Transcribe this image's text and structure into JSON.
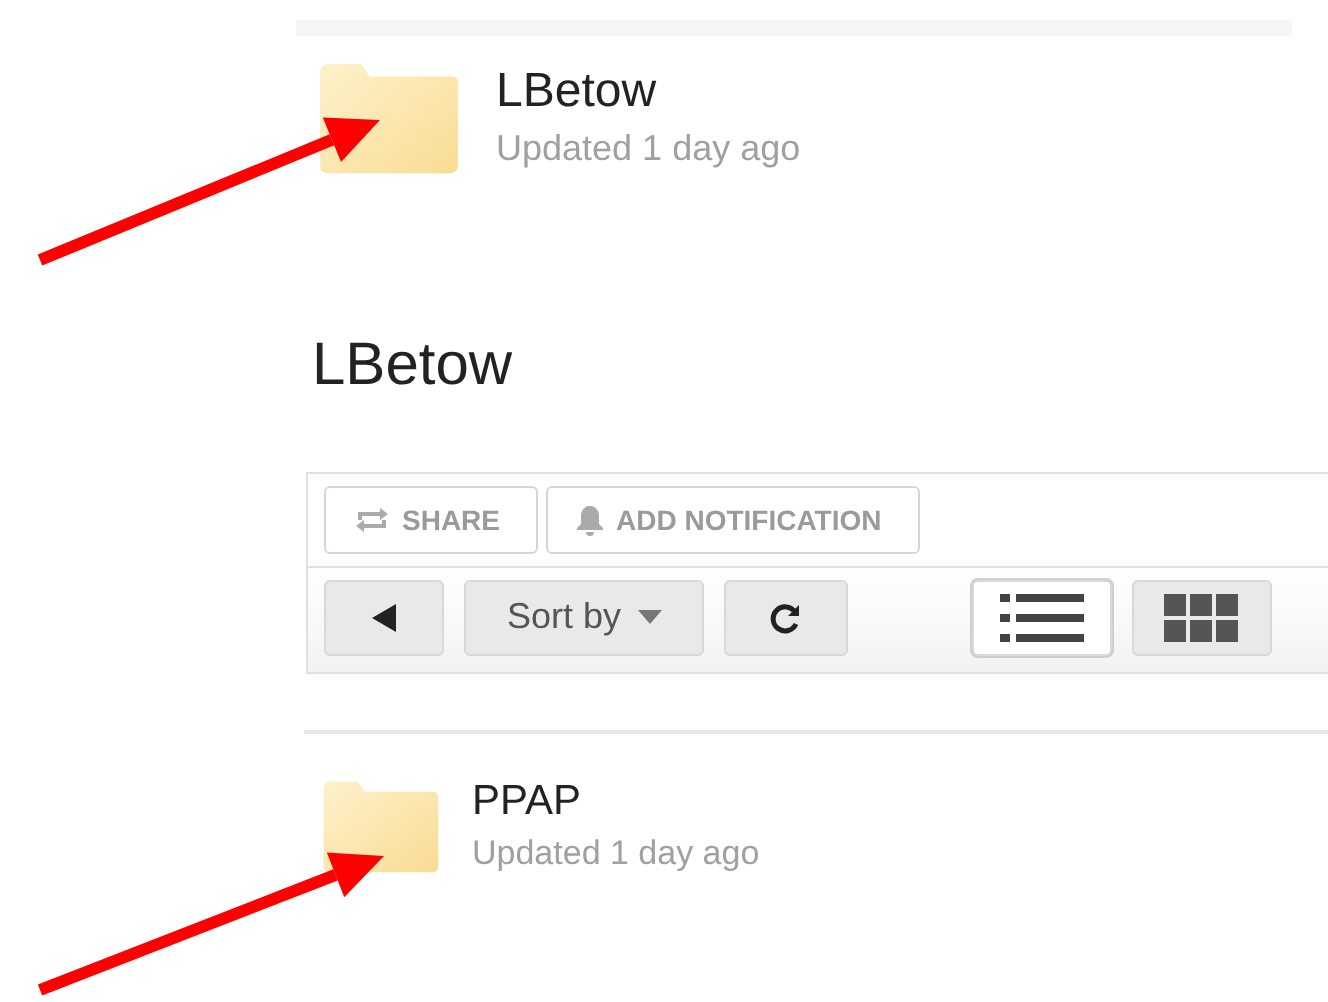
{
  "top_folder": {
    "name": "LBetow",
    "updated": "Updated 1 day ago"
  },
  "heading": "LBetow",
  "actions": [
    {
      "kind": "share",
      "label": "SHARE"
    },
    {
      "kind": "bell",
      "label": "ADD NOTIFICATION"
    }
  ],
  "nav": [
    {
      "kind": "back"
    },
    {
      "kind": "sort",
      "label": "Sort by"
    },
    {
      "kind": "refresh"
    }
  ],
  "views": [
    {
      "kind": "list",
      "selected": true
    },
    {
      "kind": "grid",
      "selected": false
    }
  ],
  "folders": [
    {
      "name": "PPAP",
      "updated": "Updated 1 day ago"
    }
  ],
  "arrows": [
    {
      "kind": "arrow"
    },
    {
      "kind": "arrow"
    }
  ]
}
